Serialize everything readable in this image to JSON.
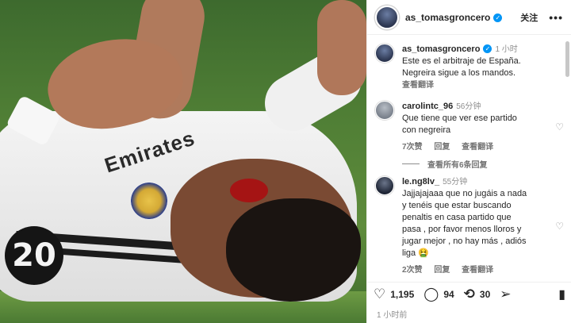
{
  "post": {
    "username": "as_tomasgroncero",
    "follow_label": "关注",
    "more_label": "•••",
    "caption_time": "1 小时",
    "caption_lines": [
      "Este es el arbitraje de España.",
      "Negreira sigue a los mandos."
    ],
    "translate_label": "查看翻译",
    "post_time": "1 小时前"
  },
  "photo": {
    "sponsor_text": "Emirates",
    "shirt_number": "20"
  },
  "comments": [
    {
      "username": "carolintc_96",
      "time": "56分钟",
      "lines": [
        "Que tiene que ver ese partido",
        "con negreira"
      ],
      "likes": "7次赞",
      "reply": "回复",
      "translate": "查看翻译"
    },
    {
      "username": "le.ng8lv_",
      "time": "55分钟",
      "lines": [
        "Jajjajajaaa que no jugáis a nada",
        "y tenéis que estar buscando",
        "penaltis en casa partido que",
        "pasa , por favor menos lloros y",
        "jugar mejor , no hay más , adiós",
        "liga 🤮"
      ],
      "likes": "2次赞",
      "reply": "回复",
      "translate": "查看翻译"
    }
  ],
  "view_replies": "查看所有6条回复",
  "actions": {
    "likes": "1,195",
    "comments": "94",
    "shares": "30"
  },
  "icons": {
    "verified": "verified-badge-icon",
    "heart": "heart-icon",
    "comment": "comment-icon",
    "repost": "repost-icon",
    "share": "share-icon",
    "bookmark": "bookmark-icon"
  }
}
